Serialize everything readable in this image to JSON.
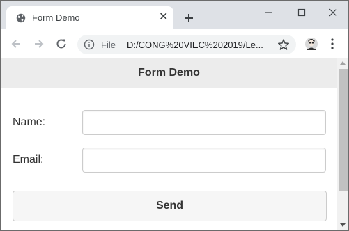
{
  "browser": {
    "tab_title": "Form Demo",
    "tab_close": "✕",
    "scheme": "File",
    "url": "D:/CONG%20VIEC%202019/Le...",
    "icons": {
      "favicon": "globe-icon",
      "new_tab": "plus-icon",
      "back": "back-arrow-icon",
      "forward": "forward-arrow-icon",
      "reload": "reload-icon",
      "info": "info-icon",
      "bookmark": "star-icon",
      "profile": "avatar-icon",
      "menu": "kebab-menu-icon",
      "minimize": "minimize-icon",
      "maximize": "maximize-icon",
      "close": "close-icon"
    },
    "colors": {
      "tabstrip": "#dee1e6",
      "toolbar": "#ffffff",
      "omnibox": "#f1f3f4"
    }
  },
  "page": {
    "title": "Form Demo",
    "form": {
      "name_label": "Name:",
      "name_value": "",
      "email_label": "Email:",
      "email_value": "",
      "send_label": "Send"
    },
    "colors": {
      "header_bg": "#ececec",
      "button_bg": "#f6f6f6",
      "text": "#333333"
    }
  }
}
